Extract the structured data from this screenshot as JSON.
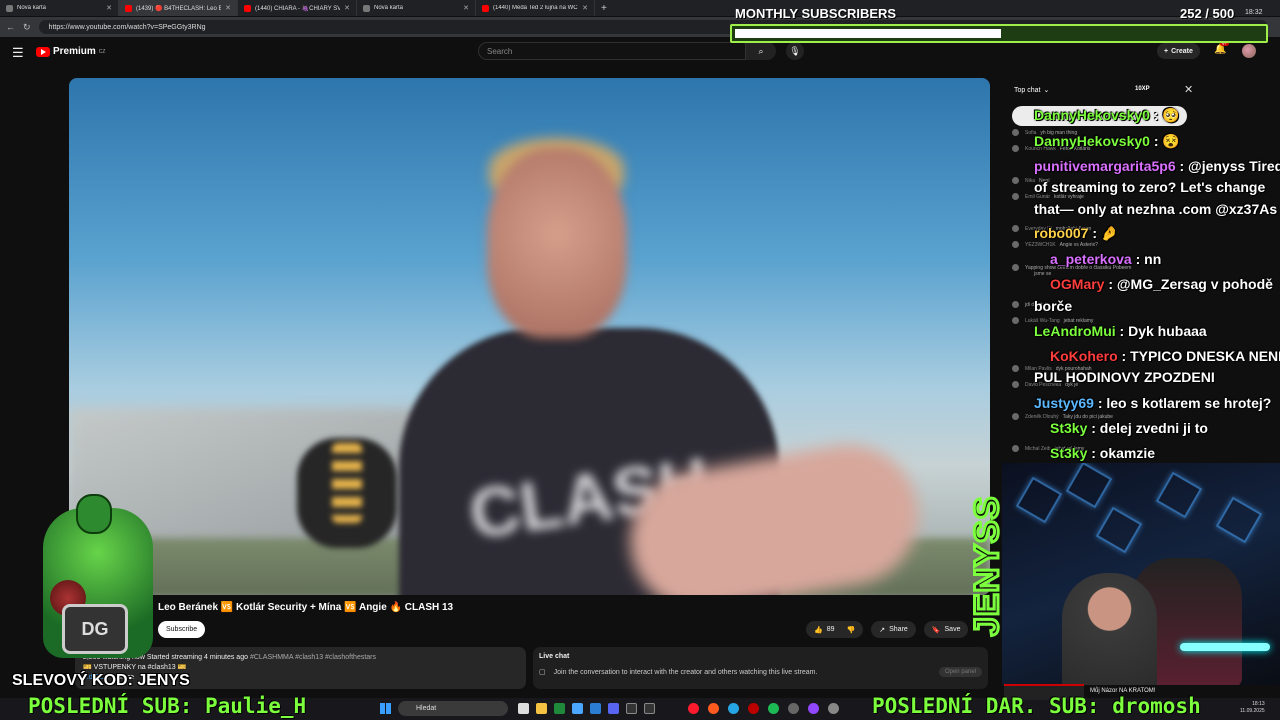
{
  "browser": {
    "tabs": [
      {
        "label": "Nová karta",
        "icon": "tab-icon",
        "active": false
      },
      {
        "label": "(1439) 🔴 B4THECLASH: Leo Beránek",
        "icon": "youtube-icon",
        "active": true
      },
      {
        "label": "(1440) CHIARA - 🍇CHIARY SVĚT",
        "icon": "youtube-icon",
        "active": false
      },
      {
        "label": "Nová karta",
        "icon": "tab-icon",
        "active": false
      },
      {
        "label": "(1440) Meda Ted 2 lujna na WC",
        "icon": "youtube-icon",
        "active": false
      }
    ],
    "new_tab": "+",
    "url": "https://www.youtube.com/watch?v=SPeGGty3RNg"
  },
  "youtube": {
    "brand": "Premium",
    "region": "CZ",
    "search_placeholder": "Search",
    "create_label": "Create",
    "notif_count": "9+"
  },
  "video": {
    "title": "Leo Beránek 🆚 Kotlár Security + Mína 🆚 Angie 🔥 CLASH 13",
    "subscribe_label": "Subscribe",
    "likes": "89",
    "share_label": "Share",
    "save_label": "Save"
  },
  "description": {
    "stats": "2,209 watching now  Started streaming 4 minutes ago",
    "tags": "#CLASHMMA #clash13 #clashofthestars",
    "line2": "🎫 VSTUPENKY na #clash13 🎫",
    "link": "...d/CLA",
    "more": "...more"
  },
  "livechat": {
    "label": "Live chat",
    "join_text": "Join the conversation to interact with the creator and others watching this live stream.",
    "open_panel": "Open panel"
  },
  "chat": {
    "header": "Top chat",
    "lines": [
      {
        "user": "Sofia",
        "text": "yh big man thing"
      },
      {
        "user": "Kourich Hawk",
        "text": "Fetos Kotláris"
      },
      {
        "user": "Nika",
        "text": "Není"
      },
      {
        "user": "Emil Gunár",
        "text": "kotlár vyhraje"
      },
      {
        "user": "Everyday Ki",
        "text": "mohallahi Amen"
      },
      {
        "user": "YEZ3WCH1K",
        "text": "Angie vs Asterix?"
      },
      {
        "user": "",
        "text": "Yapping show čemem dobře o člassiku Pobeem"
      },
      {
        "user": "",
        "text": "jsme se"
      },
      {
        "user": "",
        "text": "jdi do pici"
      },
      {
        "user": "Lukáš Wu-Tang",
        "text": "jebat reklamy"
      },
      {
        "user": "Milan Pavlis",
        "text": "dyk pourohahah"
      },
      {
        "user": "David Pescheka",
        "text": "dyk je"
      },
      {
        "user": "Zdeněk Dlouhý",
        "text": "Taky jdu do pici jakube"
      },
      {
        "user": "Michal Zeib",
        "text": "jebat reklamy"
      }
    ]
  },
  "overlay": {
    "monthly_label": "MONTHLY SUBSCRIBERS",
    "monthly_count": "252  / 500",
    "monthly_progress": 0.504,
    "clock": "18:32",
    "xp": "10XP",
    "messages": [
      {
        "name": "DannyHekovsky0",
        "text": " : 🥺",
        "color": "green"
      },
      {
        "name": "DannyHekovsky0",
        "text": " : 😵",
        "color": "green"
      },
      {
        "name": "punitivemargarita5p6",
        "text": " : @jenyss Tired",
        "color": "pink"
      },
      {
        "name": "",
        "text": "of streaming to zero? Let's change",
        "color": "white"
      },
      {
        "name": "",
        "text": "that— only at nezhna .com @xz37As",
        "color": "white"
      },
      {
        "name": "robo007",
        "text": " : 🤌",
        "color": "gold"
      },
      {
        "name": "a_peterkova",
        "text": " : nn",
        "color": "pink"
      },
      {
        "name": "OGMary",
        "text": " : @MG_Zersag v pohodě",
        "color": "red"
      },
      {
        "name": "",
        "text": "borče",
        "color": "white"
      },
      {
        "name": "LeAndroMui",
        "text": " : Dyk hubaaa",
        "color": "green"
      },
      {
        "name": "KoKohero",
        "text": " : TYPICO DNESKA NENI",
        "color": "red"
      },
      {
        "name": "",
        "text": "PUL HODINOVY ZPOZDENI",
        "color": "white"
      },
      {
        "name": "Justyy69",
        "text": " : leo s kotlarem se hrotej?",
        "color": "blue"
      },
      {
        "name": "St3ky",
        "text": " : delej zvedni ji to",
        "color": "green"
      },
      {
        "name": "St3ky",
        "text": " : okamzie",
        "color": "green"
      }
    ],
    "streamer_logo": "JENYSS",
    "promo": "SLEVOVÝ KOD: JENYS",
    "booster": "DG",
    "last_sub": "POSLEDNÍ SUB: Paulie_H",
    "last_gift": "POSLEDNÍ DAR. SUB: dromosh",
    "cam_caption": "Můj Názor NA KRATOM!"
  },
  "taskbar": {
    "search_placeholder": "Hledat",
    "time": "18:13",
    "date": "11.09.2025"
  }
}
